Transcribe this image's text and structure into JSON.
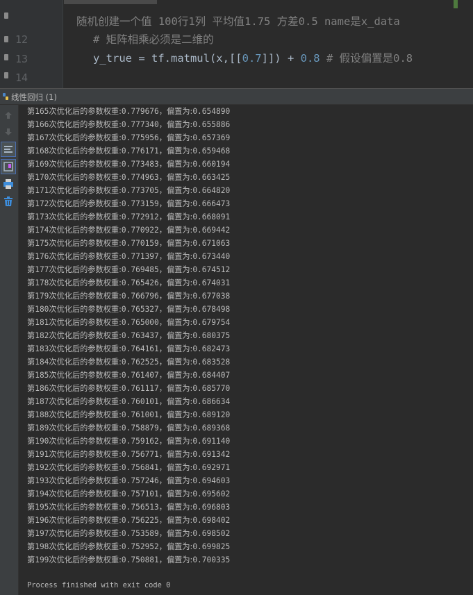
{
  "editor": {
    "line_numbers": [
      "12",
      "13",
      "14"
    ],
    "comment_line": "随机创建一个值 100行1列 平均值1.75 方差0.5 name是x_data",
    "line12_comment": "# 矩阵相乘必须是二维的",
    "line13": {
      "code_a": "y_true = tf.matmul(x,[[",
      "num_a": "0.7",
      "code_b": "]]) + ",
      "num_b": "0.8",
      "comment": " # 假设偏置是0.8"
    }
  },
  "run_panel": {
    "title": "线性回归 (1)"
  },
  "toolbar": {
    "icons": [
      "up-arrow-icon",
      "down-arrow-icon",
      "soft-wrap-icon",
      "scroll-to-end-icon",
      "print-icon",
      "trash-icon"
    ]
  },
  "console": {
    "rows": [
      {
        "step": "165",
        "label_a": "次优化后的参数权重:",
        "weight": "0.779676",
        "label_b": "，偏置为:",
        "bias": "0.654890"
      },
      {
        "step": "166",
        "label_a": "次优化后的参数权重:",
        "weight": "0.777340",
        "label_b": "，偏置为:",
        "bias": "0.655886"
      },
      {
        "step": "167",
        "label_a": "次优化后的参数权重:",
        "weight": "0.775956",
        "label_b": "，偏置为:",
        "bias": "0.657369"
      },
      {
        "step": "168",
        "label_a": "次优化后的参数权重:",
        "weight": "0.776171",
        "label_b": "，偏置为:",
        "bias": "0.659468"
      },
      {
        "step": "169",
        "label_a": "次优化后的参数权重:",
        "weight": "0.773483",
        "label_b": "，偏置为:",
        "bias": "0.660194"
      },
      {
        "step": "170",
        "label_a": "次优化后的参数权重:",
        "weight": "0.774963",
        "label_b": "，偏置为:",
        "bias": "0.663425"
      },
      {
        "step": "171",
        "label_a": "次优化后的参数权重:",
        "weight": "0.773705",
        "label_b": "，偏置为:",
        "bias": "0.664820"
      },
      {
        "step": "172",
        "label_a": "次优化后的参数权重:",
        "weight": "0.773159",
        "label_b": "，偏置为:",
        "bias": "0.666473"
      },
      {
        "step": "173",
        "label_a": "次优化后的参数权重:",
        "weight": "0.772912",
        "label_b": "，偏置为:",
        "bias": "0.668091"
      },
      {
        "step": "174",
        "label_a": "次优化后的参数权重:",
        "weight": "0.770922",
        "label_b": "，偏置为:",
        "bias": "0.669442"
      },
      {
        "step": "175",
        "label_a": "次优化后的参数权重:",
        "weight": "0.770159",
        "label_b": "，偏置为:",
        "bias": "0.671063"
      },
      {
        "step": "176",
        "label_a": "次优化后的参数权重:",
        "weight": "0.771397",
        "label_b": "，偏置为:",
        "bias": "0.673440"
      },
      {
        "step": "177",
        "label_a": "次优化后的参数权重:",
        "weight": "0.769485",
        "label_b": "，偏置为:",
        "bias": "0.674512"
      },
      {
        "step": "178",
        "label_a": "次优化后的参数权重:",
        "weight": "0.765426",
        "label_b": "，偏置为:",
        "bias": "0.674031"
      },
      {
        "step": "179",
        "label_a": "次优化后的参数权重:",
        "weight": "0.766796",
        "label_b": "，偏置为:",
        "bias": "0.677038"
      },
      {
        "step": "180",
        "label_a": "次优化后的参数权重:",
        "weight": "0.765327",
        "label_b": "，偏置为:",
        "bias": "0.678498"
      },
      {
        "step": "181",
        "label_a": "次优化后的参数权重:",
        "weight": "0.765000",
        "label_b": "，偏置为:",
        "bias": "0.679754"
      },
      {
        "step": "182",
        "label_a": "次优化后的参数权重:",
        "weight": "0.763437",
        "label_b": "，偏置为:",
        "bias": "0.680375"
      },
      {
        "step": "183",
        "label_a": "次优化后的参数权重:",
        "weight": "0.764161",
        "label_b": "，偏置为:",
        "bias": "0.682473"
      },
      {
        "step": "184",
        "label_a": "次优化后的参数权重:",
        "weight": "0.762525",
        "label_b": "，偏置为:",
        "bias": "0.683528"
      },
      {
        "step": "185",
        "label_a": "次优化后的参数权重:",
        "weight": "0.761407",
        "label_b": "，偏置为:",
        "bias": "0.684407"
      },
      {
        "step": "186",
        "label_a": "次优化后的参数权重:",
        "weight": "0.761117",
        "label_b": "，偏置为:",
        "bias": "0.685770"
      },
      {
        "step": "187",
        "label_a": "次优化后的参数权重:",
        "weight": "0.760101",
        "label_b": "，偏置为:",
        "bias": "0.686634"
      },
      {
        "step": "188",
        "label_a": "次优化后的参数权重:",
        "weight": "0.761001",
        "label_b": "，偏置为:",
        "bias": "0.689120"
      },
      {
        "step": "189",
        "label_a": "次优化后的参数权重:",
        "weight": "0.758879",
        "label_b": "，偏置为:",
        "bias": "0.689368"
      },
      {
        "step": "190",
        "label_a": "次优化后的参数权重:",
        "weight": "0.759162",
        "label_b": "，偏置为:",
        "bias": "0.691140"
      },
      {
        "step": "191",
        "label_a": "次优化后的参数权重:",
        "weight": "0.756771",
        "label_b": "，偏置为:",
        "bias": "0.691342"
      },
      {
        "step": "192",
        "label_a": "次优化后的参数权重:",
        "weight": "0.756841",
        "label_b": "，偏置为:",
        "bias": "0.692971"
      },
      {
        "step": "193",
        "label_a": "次优化后的参数权重:",
        "weight": "0.757246",
        "label_b": "，偏置为:",
        "bias": "0.694603"
      },
      {
        "step": "194",
        "label_a": "次优化后的参数权重:",
        "weight": "0.757101",
        "label_b": "，偏置为:",
        "bias": "0.695602"
      },
      {
        "step": "195",
        "label_a": "次优化后的参数权重:",
        "weight": "0.756513",
        "label_b": "，偏置为:",
        "bias": "0.696803"
      },
      {
        "step": "196",
        "label_a": "次优化后的参数权重:",
        "weight": "0.756225",
        "label_b": "，偏置为:",
        "bias": "0.698402"
      },
      {
        "step": "197",
        "label_a": "次优化后的参数权重:",
        "weight": "0.753589",
        "label_b": "，偏置为:",
        "bias": "0.698502"
      },
      {
        "step": "198",
        "label_a": "次优化后的参数权重:",
        "weight": "0.752952",
        "label_b": "，偏置为:",
        "bias": "0.699825"
      },
      {
        "step": "199",
        "label_a": "次优化后的参数权重:",
        "weight": "0.750881",
        "label_b": "，偏置为:",
        "bias": "0.700335"
      }
    ],
    "row_prefix": "第",
    "finish_message": "Process finished with exit code 0"
  },
  "colors": {
    "background": "#2b2b2b",
    "panel": "#3c3f41",
    "text": "#bbbbbb",
    "comment": "#808080",
    "number": "#6897bb"
  }
}
